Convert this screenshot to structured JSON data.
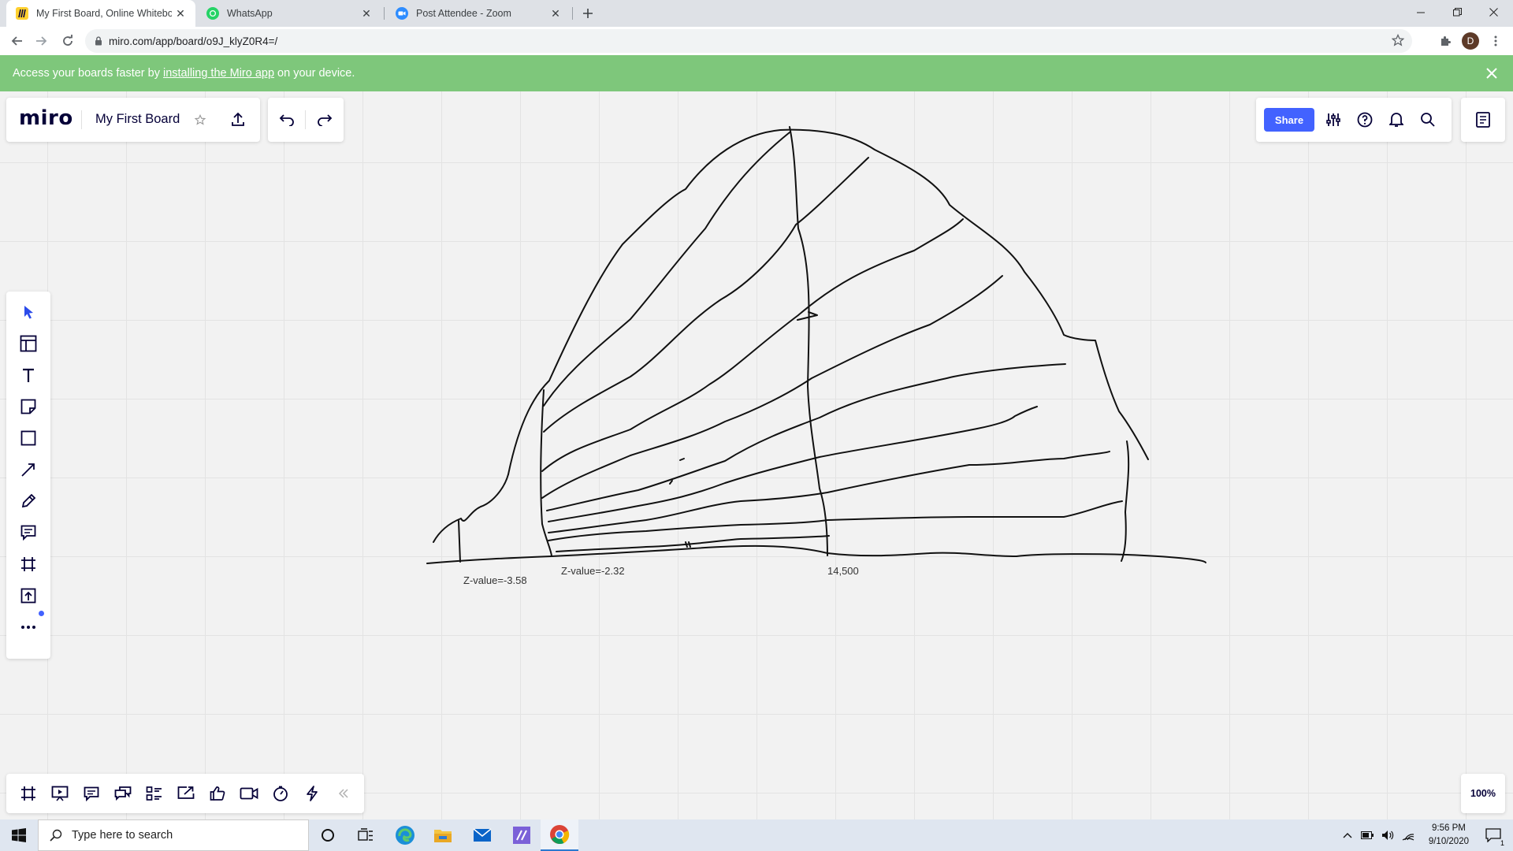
{
  "browser": {
    "tabs": [
      {
        "title": "My First Board, Online Whiteboa",
        "icon": "miro-favicon",
        "active": true
      },
      {
        "title": "WhatsApp",
        "icon": "whatsapp-favicon",
        "active": false
      },
      {
        "title": "Post Attendee - Zoom",
        "icon": "zoom-favicon",
        "active": false
      }
    ],
    "url": "miro.com/app/board/o9J_klyZ0R4=/",
    "profile_initial": "D"
  },
  "banner": {
    "text_before": "Access your boards faster by",
    "link_text": "installing the Miro app",
    "text_after": "on your device."
  },
  "miro": {
    "logo": "miro",
    "board_name": "My First Board",
    "share_label": "Share",
    "zoom": "100%"
  },
  "annotations": {
    "label_1": "Z-value=-3.58",
    "label_2": "Z-value=-2.32",
    "label_3": "14,500"
  },
  "taskbar": {
    "search_placeholder": "Type here to search",
    "time": "9:56 PM",
    "date": "9/10/2020",
    "notification_count": "1"
  },
  "colors": {
    "banner": "#7ec77b",
    "share": "#4262ff",
    "miro_favicon": "#ffd02f",
    "whatsapp": "#25d366",
    "zoom": "#2d8cff",
    "chrome_tab_strip": "#dee1e6"
  }
}
